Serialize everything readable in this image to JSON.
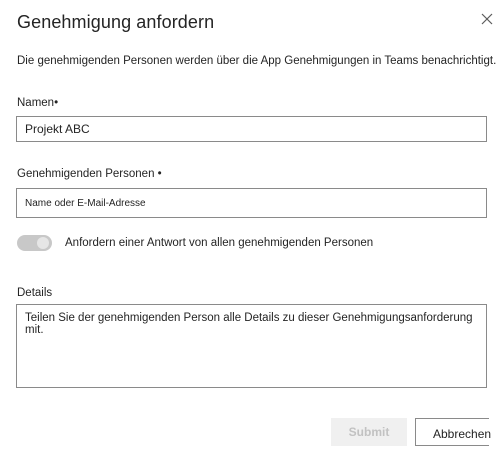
{
  "dialog": {
    "title": "Genehmigung anfordern",
    "close_icon": "close-icon",
    "description": "Die genehmigenden Personen werden über die App Genehmigungen in Teams benachrichtigt."
  },
  "form": {
    "name": {
      "label": "Namen•",
      "value": "Projekt ABC"
    },
    "approvers": {
      "label": "Genehmigenden Personen •",
      "placeholder": "Name oder E-Mail-Adresse"
    },
    "require_all": {
      "label": "Anfordern einer Antwort von allen genehmigenden Personen",
      "state": "off",
      "track_color": "#c8c8c8"
    },
    "details": {
      "label": "Details",
      "placeholder": "Teilen Sie der genehmigenden Person alle Details zu dieser Genehmigungsanforderung mit."
    }
  },
  "footer": {
    "submit_label": "Submit",
    "submit_state": "disabled",
    "cancel_label": "Abbrechen"
  }
}
